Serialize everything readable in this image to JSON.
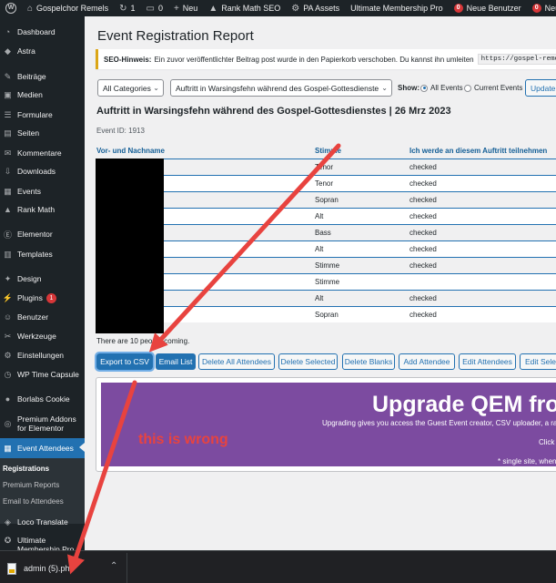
{
  "colors": {
    "admin_dark": "#1d2327",
    "accent": "#2271b1",
    "arrow": "#e8433f",
    "upgrade_bg": "#7c4ba0",
    "notice_border": "#dba617"
  },
  "adminbar": {
    "site_name": "Gospelchor Remels",
    "updates_count": "1",
    "comments_count": "0",
    "new_label": "Neu",
    "rank_math": "Rank Math SEO",
    "pa_assets": "PA Assets",
    "ump": "Ultimate Membership Pro",
    "new_users_count": "0",
    "new_users_label": "Neue Benutzer",
    "new_orders_count": "0",
    "new_orders_label": "Neue Bestellungen"
  },
  "sidebar": {
    "items": [
      {
        "label": "Dashboard",
        "icon": "dashboard-icon",
        "glyph": "◔"
      },
      {
        "label": "Astra",
        "icon": "astra-icon",
        "glyph": "◆"
      },
      {
        "label": "Beiträge",
        "icon": "pin-icon",
        "glyph": "✎"
      },
      {
        "label": "Medien",
        "icon": "media-icon",
        "glyph": "▣"
      },
      {
        "label": "Formulare",
        "icon": "forms-icon",
        "glyph": "☰"
      },
      {
        "label": "Seiten",
        "icon": "pages-icon",
        "glyph": "▤"
      },
      {
        "label": "Kommentare",
        "icon": "comments-icon",
        "glyph": "✉"
      },
      {
        "label": "Downloads",
        "icon": "downloads-icon",
        "glyph": "⇩"
      },
      {
        "label": "Events",
        "icon": "events-icon",
        "glyph": "▦"
      },
      {
        "label": "Rank Math",
        "icon": "rank-math-icon",
        "glyph": "▲"
      },
      {
        "label": "Elementor",
        "icon": "elementor-icon",
        "glyph": "Ⓔ"
      },
      {
        "label": "Templates",
        "icon": "templates-icon",
        "glyph": "▥"
      },
      {
        "label": "Design",
        "icon": "design-icon",
        "glyph": "✦"
      },
      {
        "label": "Plugins",
        "icon": "plugins-icon",
        "glyph": "⚡"
      },
      {
        "label": "Benutzer",
        "icon": "users-icon",
        "glyph": "☺"
      },
      {
        "label": "Werkzeuge",
        "icon": "tools-icon",
        "glyph": "✂"
      },
      {
        "label": "Einstellungen",
        "icon": "settings-icon",
        "glyph": "⚙"
      },
      {
        "label": "WP Time Capsule",
        "icon": "time-capsule-icon",
        "glyph": "◷"
      },
      {
        "label": "Borlabs Cookie",
        "icon": "cookie-icon",
        "glyph": "●"
      },
      {
        "label": "Premium Addons for Elementor",
        "icon": "premium-addons-icon",
        "glyph": "◎"
      },
      {
        "label": "Event Attendees",
        "icon": "attendees-icon",
        "glyph": "▦"
      },
      {
        "label": "Loco Translate",
        "icon": "loco-icon",
        "glyph": "◈"
      },
      {
        "label": "Ultimate Membership Pro",
        "icon": "membership-icon",
        "glyph": "✪"
      }
    ],
    "plugins_badge": "1",
    "submenu": [
      "Registrations",
      "Premium Reports",
      "Email to Attendees"
    ]
  },
  "page": {
    "title": "Event Registration Report",
    "seo_notice_label": "SEO-Hinweis:",
    "seo_notice_text": "Ein zuvor veröffentlichter Beitrag post wurde in den Papierkorb verschoben. Du kannst ihn umleiten",
    "seo_notice_url": "https://gospel-remels",
    "category_select": "All Categories",
    "event_select": "Auftritt in Warsingsfehn während des Gospel-Gottesdienste",
    "show_label": "Show:",
    "radio_all": "All Events",
    "radio_current": "Current Events",
    "update_button": "Update",
    "event_heading": "Auftritt in Warsingsfehn während des Gospel-Gottesdienstes | 26 Mrz 2023",
    "event_id": "Event ID: 1913",
    "columns": [
      "Vor- und Nachname",
      "Stimme",
      "Ich werde an diesem Auftritt teilnehmen"
    ],
    "rows": [
      {
        "voice": "Tenor",
        "attend": "checked"
      },
      {
        "voice": "Tenor",
        "attend": "checked"
      },
      {
        "voice": "Sopran",
        "attend": "checked"
      },
      {
        "voice": "Alt",
        "attend": "checked"
      },
      {
        "voice": "Bass",
        "attend": "checked"
      },
      {
        "voice": "Alt",
        "attend": "checked"
      },
      {
        "voice": "Stimme",
        "attend": "checked"
      },
      {
        "voice": "Stimme",
        "attend": ""
      },
      {
        "voice": "Alt",
        "attend": "checked"
      },
      {
        "voice": "Sopran",
        "attend": "checked"
      }
    ],
    "attendee_count": "There are 10 people coming.",
    "buttons": [
      "Export to CSV",
      "Email List",
      "Delete All Attendees",
      "Delete Selected",
      "Delete Blanks",
      "Add Attendee",
      "Edit Attendees",
      "Edit Selected"
    ],
    "upgrade_title": "Upgrade QEM from",
    "upgrade_sub": "Upgrading gives you access the Guest Event creator, CSV uploader, a range",
    "upgrade_click": "Click to",
    "upgrade_note": "* single site, when p",
    "annotation": "this is wrong"
  },
  "downloadbar": {
    "filename": "admin (5).php"
  }
}
